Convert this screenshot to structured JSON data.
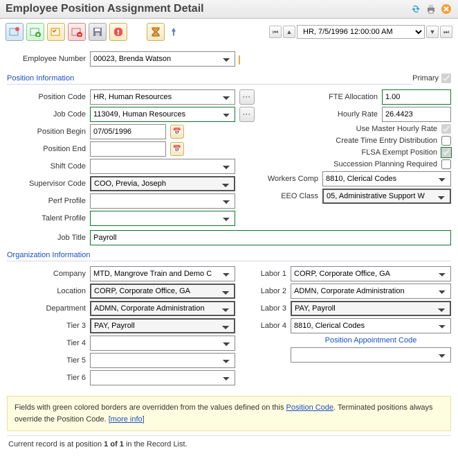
{
  "page_title": "Employee Position Assignment Detail",
  "nav_value": "HR, 7/5/1996 12:00:00 AM",
  "employee_number": {
    "label": "Employee Number",
    "value": "00023, Brenda Watson"
  },
  "section1_title": "Position Information",
  "primary": {
    "label": "Primary",
    "checked": true
  },
  "position_code": {
    "label": "Position Code",
    "value": "HR, Human Resources"
  },
  "job_code": {
    "label": "Job Code",
    "value": "113049, Human Resources"
  },
  "fte_allocation": {
    "label": "FTE Allocation",
    "value": "1.00"
  },
  "hourly_rate": {
    "label": "Hourly Rate",
    "value": "26.4423"
  },
  "position_begin": {
    "label": "Position Begin",
    "value": "07/05/1996"
  },
  "position_end": {
    "label": "Position End",
    "value": ""
  },
  "use_master_hourly": {
    "label": "Use Master Hourly Rate",
    "checked": true
  },
  "create_time_entry": {
    "label": "Create Time Entry Distribution",
    "checked": false
  },
  "flsa_exempt": {
    "label": "FLSA Exempt Position",
    "checked": true
  },
  "succession": {
    "label": "Succession Planning Required",
    "checked": false
  },
  "shift_code": {
    "label": "Shift Code",
    "value": ""
  },
  "supervisor_code": {
    "label": "Supervisor Code",
    "value": "COO, Previa, Joseph"
  },
  "perf_profile": {
    "label": "Perf Profile",
    "value": ""
  },
  "talent_profile": {
    "label": "Talent Profile",
    "value": ""
  },
  "workers_comp": {
    "label": "Workers Comp",
    "value": "8810, Clerical Codes"
  },
  "eeo_class": {
    "label": "EEO Class",
    "value": "05, Administrative Support W"
  },
  "job_title": {
    "label": "Job Title",
    "value": "Payroll"
  },
  "section2_title": "Organization Information",
  "company": {
    "label": "Company",
    "value": "MTD, Mangrove Train and Demo C"
  },
  "location": {
    "label": "Location",
    "value": "CORP, Corporate Office, GA"
  },
  "department": {
    "label": "Department",
    "value": "ADMN, Corporate Administration"
  },
  "tier3": {
    "label": "Tier 3",
    "value": "PAY, Payroll"
  },
  "tier4": {
    "label": "Tier 4",
    "value": ""
  },
  "tier5": {
    "label": "Tier 5",
    "value": ""
  },
  "tier6": {
    "label": "Tier 6",
    "value": ""
  },
  "labor1": {
    "label": "Labor 1",
    "value": "CORP, Corporate Office, GA"
  },
  "labor2": {
    "label": "Labor 2",
    "value": "ADMN, Corporate Administration"
  },
  "labor3": {
    "label": "Labor 3",
    "value": "PAY, Payroll"
  },
  "labor4": {
    "label": "Labor 4",
    "value": "8810, Clerical Codes"
  },
  "pos_appt_label": "Position Appointment Code",
  "pos_appt_value": "",
  "note_text1": "Fields with green colored borders are overridden from the values defined on this ",
  "note_link1": "Position Code",
  "note_text2": ". Terminated positions always override the Position Code. ",
  "note_link2": "[more info]",
  "footer_pre": "Current record is at position ",
  "footer_bold": "1 of 1",
  "footer_post": " in the Record List."
}
